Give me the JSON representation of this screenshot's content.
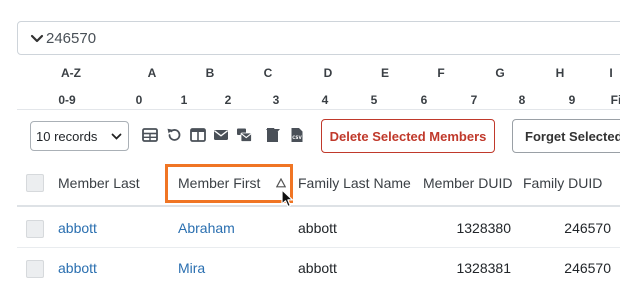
{
  "search": {
    "value": "246570"
  },
  "letters_row1": [
    "A-Z",
    "A",
    "B",
    "C",
    "D",
    "E",
    "F",
    "G",
    "H",
    "I"
  ],
  "letters_row2": [
    "0-9",
    "0",
    "1",
    "2",
    "3",
    "4",
    "5",
    "6",
    "7",
    "8",
    "9",
    "Fi"
  ],
  "toolbar": {
    "records_label": "10 records",
    "delete_label": "Delete Selected Members",
    "forget_label": "Forget Selected"
  },
  "table": {
    "headers": [
      "Member Last",
      "Member First",
      "Family Last Name",
      "Member DUID",
      "Family DUID"
    ],
    "sorted_column": "Member First",
    "rows": [
      {
        "member_last": "abbott",
        "member_first": "Abraham",
        "family_last": "abbott",
        "member_duid": "1328380",
        "family_duid": "246570"
      },
      {
        "member_last": "abbott",
        "member_first": "Mira",
        "family_last": "abbott",
        "member_duid": "1328381",
        "family_duid": "246570"
      }
    ]
  },
  "colors": {
    "accent_link": "#2a6fb0",
    "danger": "#c0392b",
    "highlight": "#f07524"
  }
}
